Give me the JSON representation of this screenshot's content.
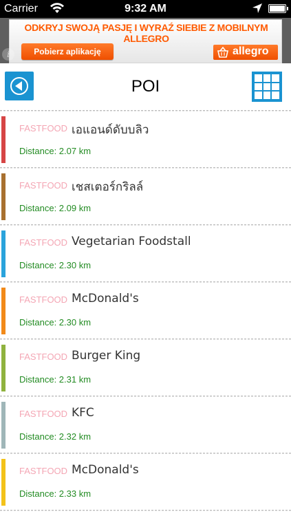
{
  "status_bar": {
    "carrier": "Carrier",
    "time": "9:32 AM",
    "wifi_icon": "wifi-icon",
    "location_icon": "location-arrow-icon",
    "battery_icon": "battery-icon"
  },
  "ad": {
    "headline": "ODKRYJ SWOJĄ PASJĘ I WYRAŹ SIEBIE Z MOBILNYM ALLEGRO",
    "button_label": "Pobierz aplikację",
    "logo_text": "allegro",
    "info_label": "i",
    "accent_color": "#ff5a00"
  },
  "header": {
    "title": "POI",
    "back_icon": "back-arrow-circle-icon",
    "grid_icon": "grid-view-icon",
    "accent_color": "#1a93d1"
  },
  "items": [
    {
      "category": "FASTFOOD",
      "name": "เอแอนด์ดับบลิว",
      "distance": "Distance: 2.07 km",
      "color": "#d64545"
    },
    {
      "category": "FASTFOOD",
      "name": "เชสเตอร์กริลล์",
      "distance": "Distance: 2.09 km",
      "color": "#a8702f"
    },
    {
      "category": "FASTFOOD",
      "name": "Vegetarian Foodstall",
      "distance": "Distance: 2.30 km",
      "color": "#2aa3dc"
    },
    {
      "category": "FASTFOOD",
      "name": "McDonald's",
      "distance": "Distance: 2.30 km",
      "color": "#f28a1a"
    },
    {
      "category": "FASTFOOD",
      "name": "Burger King",
      "distance": "Distance: 2.31 km",
      "color": "#8fb23e"
    },
    {
      "category": "FASTFOOD",
      "name": "KFC",
      "distance": "Distance: 2.32 km",
      "color": "#9fb6b8"
    },
    {
      "category": "FASTFOOD",
      "name": "McDonald's",
      "distance": "Distance: 2.33 km",
      "color": "#f3c21a"
    }
  ]
}
